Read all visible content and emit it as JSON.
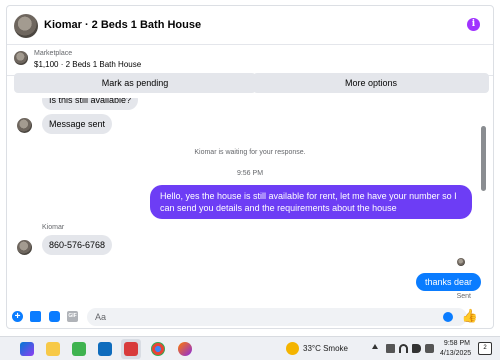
{
  "header": {
    "title": "Kiomar · 2 Beds 1 Bath House"
  },
  "listing": {
    "label": "Marketplace",
    "price_title": "$1,100 · 2 Beds 1 Bath House"
  },
  "actions": {
    "pending_label": "Mark as pending",
    "options_label": "More options"
  },
  "messages": {
    "partial_text": "Is this still available?",
    "sent_text": "Message sent",
    "waiting_notice": "Kiomar is waiting for your response.",
    "time_divider": "9:56 PM",
    "outgoing_text": "Hello, yes the house is still available for rent, let me have your number so I can send you details and the requirements about the house",
    "sender_name": "Kiomar",
    "phone_text": "860-576-6768",
    "reply_text": "thanks dear",
    "sent_status": "Sent"
  },
  "composer": {
    "placeholder": "Aa"
  },
  "taskbar": {
    "weather": "33°C  Smoke",
    "time": "9:58 PM",
    "date": "4/13/2025",
    "notification_count": "2"
  },
  "colors": {
    "accent": "#0a7cff",
    "outgoing_bubble": "#6d3df5",
    "info_icon": "#a033ff"
  }
}
